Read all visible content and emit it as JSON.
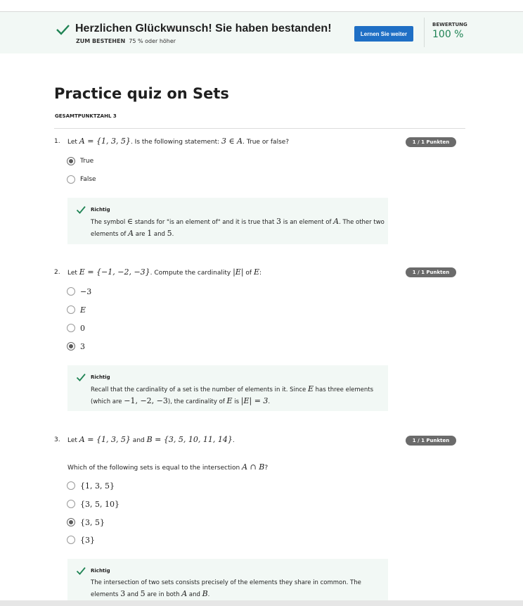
{
  "banner": {
    "title": "Herzlichen Glückwunsch! Sie haben bestanden!",
    "pass_label": "ZUM BESTEHEN",
    "pass_value": "75 % oder höher",
    "button_label": "Lernen Sie weiter",
    "grade_label": "BEWERTUNG",
    "grade_value": "100 %",
    "accent_color": "#1f8354",
    "button_color": "#1f6fc5"
  },
  "quiz": {
    "title": "Practice quiz on Sets",
    "total_points": "GESAMTPUNKTZAHL 3"
  },
  "questions": [
    {
      "number": "1.",
      "points": "1 / 1 Punkten",
      "text_a": "Let ",
      "math_a": "A = {1, 3, 5}",
      "text_b": ". Is the following statement: ",
      "math_b": "3 ∈ A",
      "text_c": ". True or false?",
      "options": [
        {
          "label": "True",
          "selected": true
        },
        {
          "label": "False",
          "selected": false
        }
      ],
      "feedback_label": "Richtig",
      "feedback_line1_a": "The symbol ",
      "feedback_line1_m": "∈",
      "feedback_line1_b": " stands for \"is an element of\" and it is true that ",
      "feedback_line1_m2": "3",
      "feedback_line1_c": " is an element of ",
      "feedback_line1_m3": "A",
      "feedback_line1_d": ". The other two",
      "feedback_line2_a": "elements of ",
      "feedback_line2_m": "A",
      "feedback_line2_b": " are ",
      "feedback_line2_m2": "1",
      "feedback_line2_c": " and ",
      "feedback_line2_m3": "5",
      "feedback_line2_d": "."
    },
    {
      "number": "2.",
      "points": "1 / 1 Punkten",
      "text_a": "Let ",
      "math_a": "E = {−1, −2, −3}",
      "text_b": ". Compute the cardinality ",
      "math_b": "|E|",
      "text_c": " of ",
      "math_c": "E",
      "text_d": ":",
      "options": [
        {
          "label": "−3",
          "selected": false
        },
        {
          "label": "E",
          "selected": false
        },
        {
          "label": "0",
          "selected": false
        },
        {
          "label": "3",
          "selected": true
        }
      ],
      "feedback_label": "Richtig",
      "feedback_line1_a": "Recall that the cardinality of a set is the number of elements in it. Since ",
      "feedback_line1_m": "E",
      "feedback_line1_b": " has three elements",
      "feedback_line2_a": "(which are ",
      "feedback_line2_m": "−1, −2, −3",
      "feedback_line2_b": "), the cardinality of ",
      "feedback_line2_m2": "E",
      "feedback_line2_c": " is ",
      "feedback_line2_m3": "|E| = 3",
      "feedback_line2_d": "."
    },
    {
      "number": "3.",
      "points": "1 / 1 Punkten",
      "text_a": "Let ",
      "math_a": "A = {1, 3, 5}",
      "text_b": " and ",
      "math_b": "B = {3, 5, 10, 11, 14}",
      "text_c": ".",
      "sub_a": "Which of the following sets is equal to the intersection ",
      "sub_m": "A ∩ B",
      "sub_b": "?",
      "options": [
        {
          "label": "{1, 3, 5}",
          "selected": false
        },
        {
          "label": "{3, 5, 10}",
          "selected": false
        },
        {
          "label": "{3, 5}",
          "selected": true
        },
        {
          "label": "{3}",
          "selected": false
        }
      ],
      "feedback_label": "Richtig",
      "feedback_line1_a": "The intersection of two sets consists precisely of the elements they share in common. The",
      "feedback_line2_a": "elements ",
      "feedback_line2_m": "3",
      "feedback_line2_b": " and ",
      "feedback_line2_m2": "5",
      "feedback_line2_c": " are in both ",
      "feedback_line2_m3": "A",
      "feedback_line2_d": " and ",
      "feedback_line2_m4": "B",
      "feedback_line2_e": "."
    }
  ]
}
